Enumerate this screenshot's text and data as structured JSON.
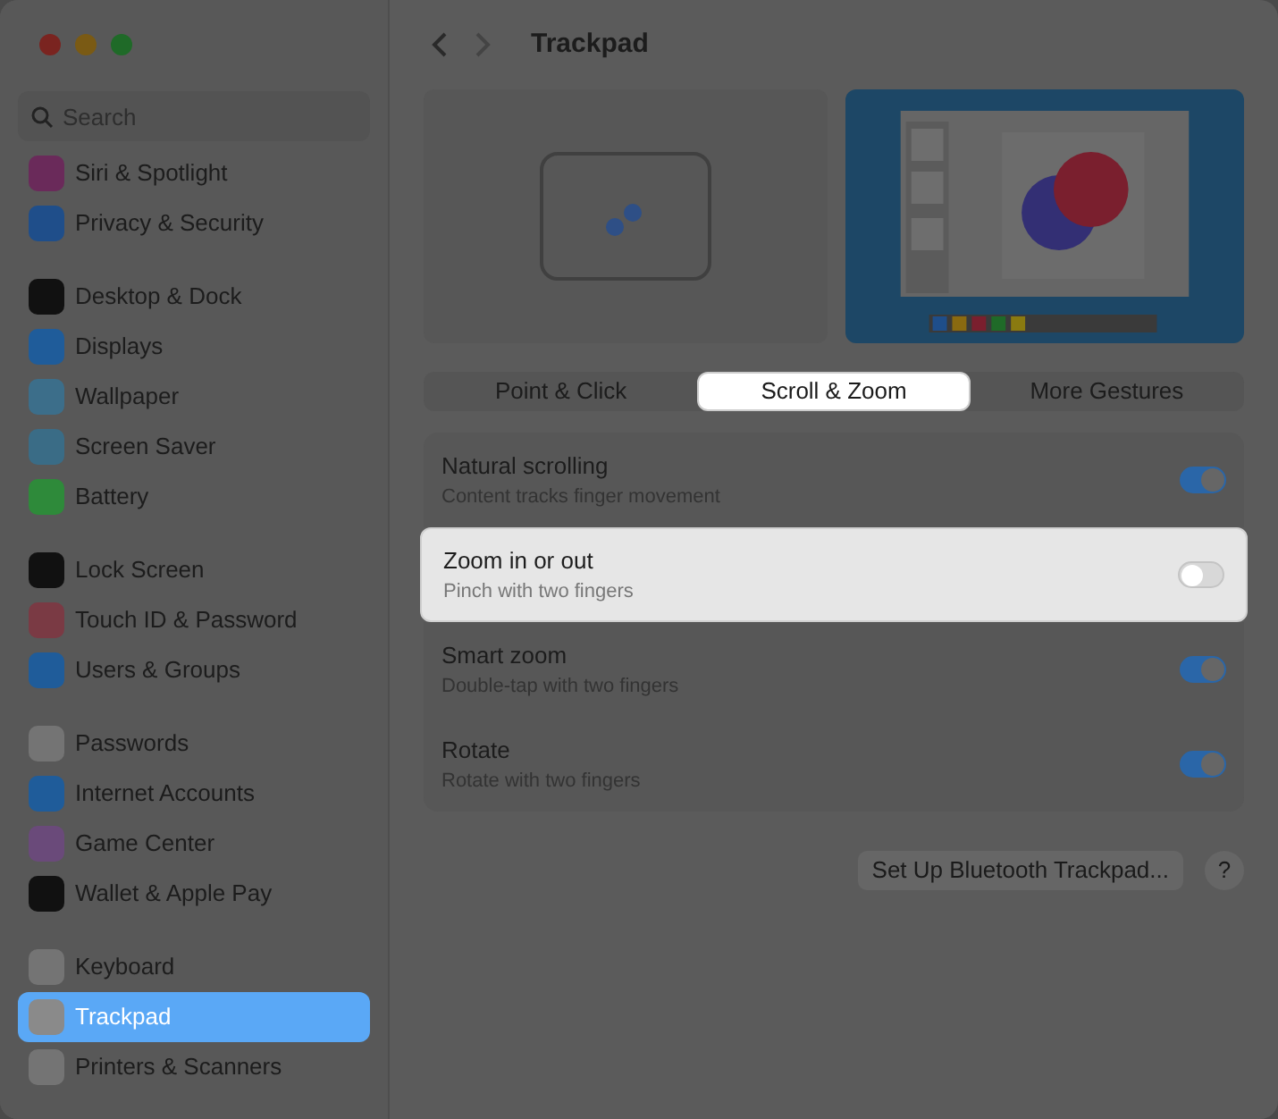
{
  "window": {
    "title": "Trackpad"
  },
  "search": {
    "placeholder": "Search"
  },
  "sidebar": {
    "groups": [
      {
        "items": [
          {
            "label": "Siri & Spotlight",
            "color": "#6a2a5a",
            "selected": false
          },
          {
            "label": "Privacy & Security",
            "color": "#1f4e8a",
            "selected": false
          }
        ]
      },
      {
        "items": [
          {
            "label": "Desktop & Dock",
            "color": "#111111",
            "selected": false
          },
          {
            "label": "Displays",
            "color": "#1f5c9a",
            "selected": false
          },
          {
            "label": "Wallpaper",
            "color": "#3c6e8a",
            "selected": false
          },
          {
            "label": "Screen Saver",
            "color": "#3a6c86",
            "selected": false
          },
          {
            "label": "Battery",
            "color": "#2e8a3a",
            "selected": false
          }
        ]
      },
      {
        "items": [
          {
            "label": "Lock Screen",
            "color": "#111111",
            "selected": false
          },
          {
            "label": "Touch ID & Password",
            "color": "#7a3a44",
            "selected": false
          },
          {
            "label": "Users & Groups",
            "color": "#1f5c9a",
            "selected": false
          }
        ]
      },
      {
        "items": [
          {
            "label": "Passwords",
            "color": "#747474",
            "selected": false
          },
          {
            "label": "Internet Accounts",
            "color": "#1f5c9a",
            "selected": false
          },
          {
            "label": "Game Center",
            "color": "#6a4a7a",
            "selected": false
          },
          {
            "label": "Wallet & Apple Pay",
            "color": "#111111",
            "selected": false
          }
        ]
      },
      {
        "items": [
          {
            "label": "Keyboard",
            "color": "#747474",
            "selected": false
          },
          {
            "label": "Trackpad",
            "color": "#8a8a8a",
            "selected": true
          },
          {
            "label": "Printers & Scanners",
            "color": "#747474",
            "selected": false
          }
        ]
      }
    ]
  },
  "tabs": [
    {
      "label": "Point & Click",
      "selected": false
    },
    {
      "label": "Scroll & Zoom",
      "selected": true
    },
    {
      "label": "More Gestures",
      "selected": false
    }
  ],
  "settings": [
    {
      "label": "Natural scrolling",
      "description": "Content tracks finger movement",
      "on": true,
      "highlighted": false
    },
    {
      "label": "Zoom in or out",
      "description": "Pinch with two fingers",
      "on": false,
      "highlighted": true
    },
    {
      "label": "Smart zoom",
      "description": "Double-tap with two fingers",
      "on": true,
      "highlighted": false
    },
    {
      "label": "Rotate",
      "description": "Rotate with two fingers",
      "on": true,
      "highlighted": false
    }
  ],
  "setup_button": "Set Up Bluetooth Trackpad...",
  "help_button": "?"
}
